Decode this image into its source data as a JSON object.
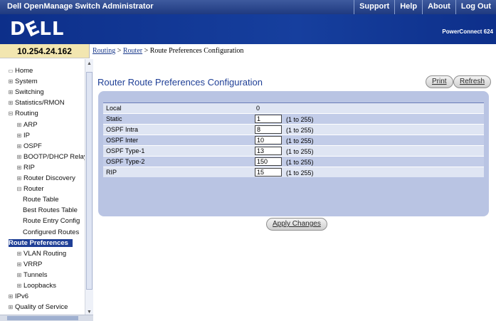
{
  "topbar": {
    "title": "Dell OpenManage Switch Administrator",
    "menu": [
      "Support",
      "Help",
      "About",
      "Log Out"
    ]
  },
  "brand": {
    "logo": "DЄLL",
    "product": "PowerConnect 624"
  },
  "address": "10.254.24.162",
  "breadcrumb": {
    "links": [
      "Routing",
      "Router"
    ],
    "separator": ">",
    "current": "Route Preferences Configuration"
  },
  "sidebar": {
    "items": [
      {
        "label": "Home",
        "icon": "home-icon"
      },
      {
        "label": "System",
        "icon": "expand-icon"
      },
      {
        "label": "Switching",
        "icon": "expand-icon"
      },
      {
        "label": "Statistics/RMON",
        "icon": "expand-icon"
      },
      {
        "label": "Routing",
        "icon": "collapse-icon"
      },
      {
        "label": "ARP",
        "icon": "expand-icon"
      },
      {
        "label": "IP",
        "icon": "expand-icon"
      },
      {
        "label": "OSPF",
        "icon": "expand-icon"
      },
      {
        "label": "BOOTP/DHCP Relay",
        "icon": "expand-icon"
      },
      {
        "label": "RIP",
        "icon": "expand-icon"
      },
      {
        "label": "Router Discovery",
        "icon": "expand-icon"
      },
      {
        "label": "Router",
        "icon": "collapse-icon"
      },
      {
        "label": "Route Table",
        "icon": ""
      },
      {
        "label": "Best Routes Table",
        "icon": ""
      },
      {
        "label": "Route Entry Config",
        "icon": ""
      },
      {
        "label": "Configured Routes",
        "icon": ""
      },
      {
        "label": "Route Preferences",
        "icon": ""
      },
      {
        "label": "VLAN Routing",
        "icon": "expand-icon"
      },
      {
        "label": "VRRP",
        "icon": "expand-icon"
      },
      {
        "label": "Tunnels",
        "icon": "expand-icon"
      },
      {
        "label": "Loopbacks",
        "icon": "expand-icon"
      },
      {
        "label": "IPv6",
        "icon": "expand-icon"
      },
      {
        "label": "Quality of Service",
        "icon": "expand-icon"
      }
    ]
  },
  "main": {
    "title": "Router Route Preferences Configuration",
    "print_label": "Print",
    "refresh_label": "Refresh",
    "apply_label": "Apply Changes",
    "rows": [
      {
        "label": "Local",
        "value": "0",
        "editable": false,
        "range": ""
      },
      {
        "label": "Static",
        "value": "1",
        "editable": true,
        "range": "(1 to 255)"
      },
      {
        "label": "OSPF Intra",
        "value": "8",
        "editable": true,
        "range": "(1 to 255)"
      },
      {
        "label": "OSPF Inter",
        "value": "10",
        "editable": true,
        "range": "(1 to 255)"
      },
      {
        "label": "OSPF Type-1",
        "value": "13",
        "editable": true,
        "range": "(1 to 255)"
      },
      {
        "label": "OSPF Type-2",
        "value": "150",
        "editable": true,
        "range": "(1 to 255)"
      },
      {
        "label": "RIP",
        "value": "15",
        "editable": true,
        "range": "(1 to 255)"
      }
    ]
  }
}
